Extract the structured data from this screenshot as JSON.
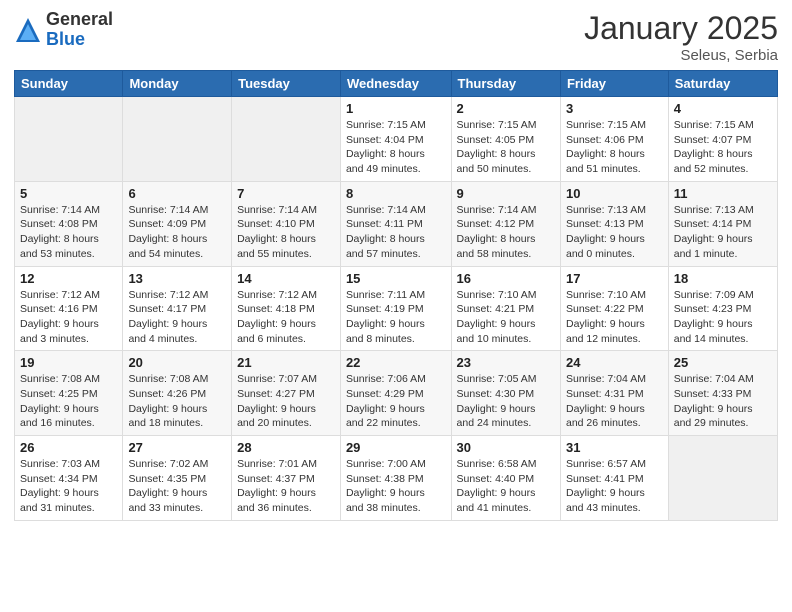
{
  "logo": {
    "general": "General",
    "blue": "Blue"
  },
  "header": {
    "month_year": "January 2025",
    "location": "Seleus, Serbia"
  },
  "weekdays": [
    "Sunday",
    "Monday",
    "Tuesday",
    "Wednesday",
    "Thursday",
    "Friday",
    "Saturday"
  ],
  "weeks": [
    [
      {
        "day": "",
        "info": ""
      },
      {
        "day": "",
        "info": ""
      },
      {
        "day": "",
        "info": ""
      },
      {
        "day": "1",
        "info": "Sunrise: 7:15 AM\nSunset: 4:04 PM\nDaylight: 8 hours\nand 49 minutes."
      },
      {
        "day": "2",
        "info": "Sunrise: 7:15 AM\nSunset: 4:05 PM\nDaylight: 8 hours\nand 50 minutes."
      },
      {
        "day": "3",
        "info": "Sunrise: 7:15 AM\nSunset: 4:06 PM\nDaylight: 8 hours\nand 51 minutes."
      },
      {
        "day": "4",
        "info": "Sunrise: 7:15 AM\nSunset: 4:07 PM\nDaylight: 8 hours\nand 52 minutes."
      }
    ],
    [
      {
        "day": "5",
        "info": "Sunrise: 7:14 AM\nSunset: 4:08 PM\nDaylight: 8 hours\nand 53 minutes."
      },
      {
        "day": "6",
        "info": "Sunrise: 7:14 AM\nSunset: 4:09 PM\nDaylight: 8 hours\nand 54 minutes."
      },
      {
        "day": "7",
        "info": "Sunrise: 7:14 AM\nSunset: 4:10 PM\nDaylight: 8 hours\nand 55 minutes."
      },
      {
        "day": "8",
        "info": "Sunrise: 7:14 AM\nSunset: 4:11 PM\nDaylight: 8 hours\nand 57 minutes."
      },
      {
        "day": "9",
        "info": "Sunrise: 7:14 AM\nSunset: 4:12 PM\nDaylight: 8 hours\nand 58 minutes."
      },
      {
        "day": "10",
        "info": "Sunrise: 7:13 AM\nSunset: 4:13 PM\nDaylight: 9 hours\nand 0 minutes."
      },
      {
        "day": "11",
        "info": "Sunrise: 7:13 AM\nSunset: 4:14 PM\nDaylight: 9 hours\nand 1 minute."
      }
    ],
    [
      {
        "day": "12",
        "info": "Sunrise: 7:12 AM\nSunset: 4:16 PM\nDaylight: 9 hours\nand 3 minutes."
      },
      {
        "day": "13",
        "info": "Sunrise: 7:12 AM\nSunset: 4:17 PM\nDaylight: 9 hours\nand 4 minutes."
      },
      {
        "day": "14",
        "info": "Sunrise: 7:12 AM\nSunset: 4:18 PM\nDaylight: 9 hours\nand 6 minutes."
      },
      {
        "day": "15",
        "info": "Sunrise: 7:11 AM\nSunset: 4:19 PM\nDaylight: 9 hours\nand 8 minutes."
      },
      {
        "day": "16",
        "info": "Sunrise: 7:10 AM\nSunset: 4:21 PM\nDaylight: 9 hours\nand 10 minutes."
      },
      {
        "day": "17",
        "info": "Sunrise: 7:10 AM\nSunset: 4:22 PM\nDaylight: 9 hours\nand 12 minutes."
      },
      {
        "day": "18",
        "info": "Sunrise: 7:09 AM\nSunset: 4:23 PM\nDaylight: 9 hours\nand 14 minutes."
      }
    ],
    [
      {
        "day": "19",
        "info": "Sunrise: 7:08 AM\nSunset: 4:25 PM\nDaylight: 9 hours\nand 16 minutes."
      },
      {
        "day": "20",
        "info": "Sunrise: 7:08 AM\nSunset: 4:26 PM\nDaylight: 9 hours\nand 18 minutes."
      },
      {
        "day": "21",
        "info": "Sunrise: 7:07 AM\nSunset: 4:27 PM\nDaylight: 9 hours\nand 20 minutes."
      },
      {
        "day": "22",
        "info": "Sunrise: 7:06 AM\nSunset: 4:29 PM\nDaylight: 9 hours\nand 22 minutes."
      },
      {
        "day": "23",
        "info": "Sunrise: 7:05 AM\nSunset: 4:30 PM\nDaylight: 9 hours\nand 24 minutes."
      },
      {
        "day": "24",
        "info": "Sunrise: 7:04 AM\nSunset: 4:31 PM\nDaylight: 9 hours\nand 26 minutes."
      },
      {
        "day": "25",
        "info": "Sunrise: 7:04 AM\nSunset: 4:33 PM\nDaylight: 9 hours\nand 29 minutes."
      }
    ],
    [
      {
        "day": "26",
        "info": "Sunrise: 7:03 AM\nSunset: 4:34 PM\nDaylight: 9 hours\nand 31 minutes."
      },
      {
        "day": "27",
        "info": "Sunrise: 7:02 AM\nSunset: 4:35 PM\nDaylight: 9 hours\nand 33 minutes."
      },
      {
        "day": "28",
        "info": "Sunrise: 7:01 AM\nSunset: 4:37 PM\nDaylight: 9 hours\nand 36 minutes."
      },
      {
        "day": "29",
        "info": "Sunrise: 7:00 AM\nSunset: 4:38 PM\nDaylight: 9 hours\nand 38 minutes."
      },
      {
        "day": "30",
        "info": "Sunrise: 6:58 AM\nSunset: 4:40 PM\nDaylight: 9 hours\nand 41 minutes."
      },
      {
        "day": "31",
        "info": "Sunrise: 6:57 AM\nSunset: 4:41 PM\nDaylight: 9 hours\nand 43 minutes."
      },
      {
        "day": "",
        "info": ""
      }
    ]
  ]
}
